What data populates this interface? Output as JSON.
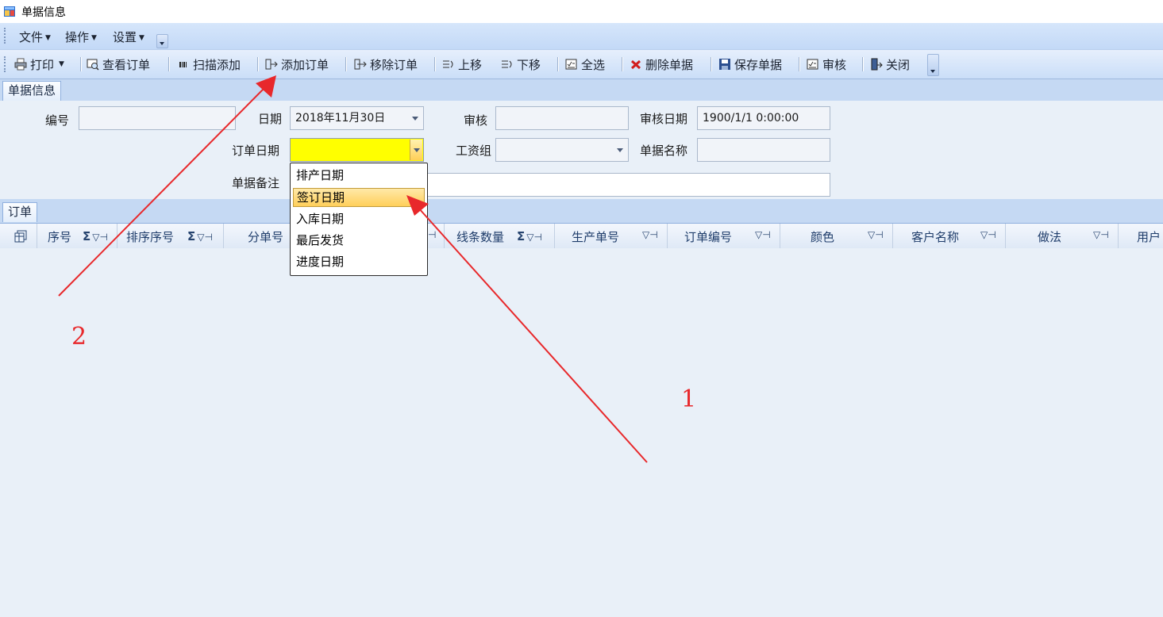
{
  "window": {
    "title": "单据信息"
  },
  "menu": {
    "items": [
      {
        "label": "文件"
      },
      {
        "label": "操作"
      },
      {
        "label": "设置"
      }
    ]
  },
  "toolbar": {
    "print": "打印",
    "view_order": "查看订单",
    "scan_add": "扫描添加",
    "add_order": "添加订单",
    "remove_order": "移除订单",
    "move_up": "上移",
    "move_down": "下移",
    "select_all": "全选",
    "delete_doc": "删除单据",
    "save_doc": "保存单据",
    "audit": "审核",
    "close": "关闭"
  },
  "tabs": {
    "doc_info": "单据信息",
    "orders": "订单"
  },
  "form": {
    "number_label": "编号",
    "number_value": "",
    "date_label": "日期",
    "date_value": "2018年11月30日",
    "audit_label": "审核",
    "audit_value": "",
    "audit_date_label": "审核日期",
    "audit_date_value": "1900/1/1 0:00:00",
    "order_date_label": "订单日期",
    "order_date_value": "",
    "wage_group_label": "工资组",
    "wage_group_value": "",
    "doc_name_label": "单据名称",
    "doc_name_value": "",
    "doc_note_label": "单据备注",
    "doc_note_value": ""
  },
  "dropdown": {
    "options": [
      "排产日期",
      "签订日期",
      "入库日期",
      "最后发货",
      "进度日期"
    ],
    "selected": "签订日期"
  },
  "grid": {
    "columns": [
      "序号",
      "排序序号",
      "分单号",
      "线条数量",
      "生产单号",
      "订单编号",
      "颜色",
      "客户名称",
      "做法",
      "用户"
    ]
  },
  "annotations": {
    "label_1": "1",
    "label_2": "2",
    "color": "#e8282b"
  },
  "colors": {
    "highlight_field": "#ffff00",
    "selection": "#ffd873",
    "panel": "#e9f0f8"
  }
}
